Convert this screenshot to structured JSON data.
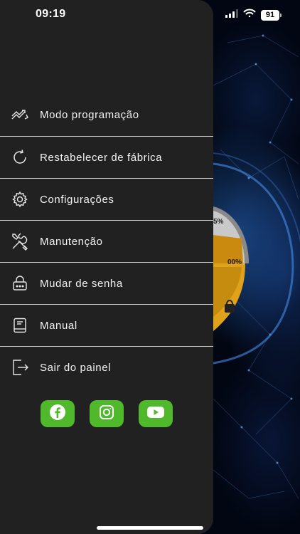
{
  "status_bar": {
    "time": "09:19",
    "battery_level": "91"
  },
  "menu": {
    "items": [
      {
        "label": "Modo programação",
        "icon": "programming-mode-icon"
      },
      {
        "label": "Restabelecer de fábrica",
        "icon": "factory-reset-icon"
      },
      {
        "label": "Configurações",
        "icon": "gear-icon"
      },
      {
        "label": "Manutenção",
        "icon": "maintenance-tools-icon"
      },
      {
        "label": "Mudar de senha",
        "icon": "password-icon"
      },
      {
        "label": "Manual",
        "icon": "manual-book-icon"
      },
      {
        "label": "Sair do painel",
        "icon": "logout-icon"
      }
    ]
  },
  "social": {
    "accent_color": "#4fb82b",
    "links": [
      {
        "name": "facebook",
        "icon": "facebook-icon"
      },
      {
        "name": "instagram",
        "icon": "instagram-icon"
      },
      {
        "name": "youtube",
        "icon": "youtube-icon"
      }
    ]
  },
  "background_app": {
    "gauge_top_text": "5%",
    "gauge_side_text": "00%"
  }
}
